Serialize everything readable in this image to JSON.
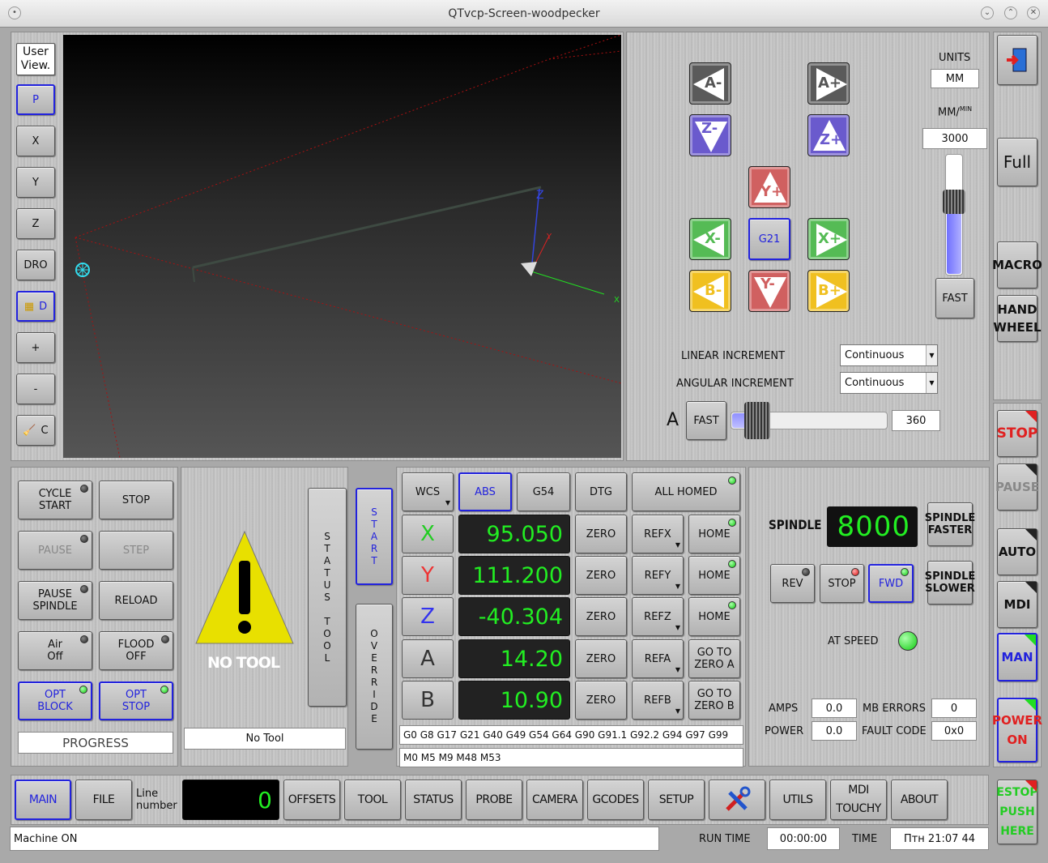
{
  "window": {
    "title": "QTvcp-Screen-woodpecker"
  },
  "view_tools": {
    "user_view": "User View.",
    "p": "P",
    "x": "X",
    "y": "Y",
    "z": "Z",
    "dro": "DRO",
    "d": "D",
    "plus": "+",
    "minus": "-",
    "c": "C"
  },
  "jog": {
    "a_minus": "A-",
    "a_plus": "A+",
    "z_minus": "Z-",
    "z_plus": "Z+",
    "y_plus": "Y+",
    "y_minus": "Y-",
    "x_minus": "X-",
    "x_plus": "X+",
    "b_minus": "B-",
    "b_plus": "B+",
    "g21": "G21",
    "units_label": "UNITS",
    "units_value": "MM",
    "rate_label": "MM/",
    "rate_sup": "MIN",
    "rate_value": "3000",
    "fast": "FAST",
    "slider_level": 0.7,
    "linear_increment_label": "LINEAR INCREMENT",
    "linear_increment_value": "Continuous",
    "angular_increment_label": "ANGULAR INCREMENT",
    "angular_increment_value": "Continuous",
    "a_label": "A",
    "a_fast": "FAST",
    "a_value": "360",
    "a_slider_level": 0.1
  },
  "right_column": {
    "full": "Full",
    "macro": "MACRO",
    "hand_wheel_1": "HAND",
    "hand_wheel_2": "WHEEL",
    "stop": "STOP",
    "pause": "PAUSE",
    "auto": "AUTO",
    "mdi": "MDI",
    "man": "MAN",
    "power_1": "POWER",
    "power_2": "ON",
    "estop_1": "ESTOP",
    "estop_2": "PUSH",
    "estop_3": "HERE"
  },
  "controls": {
    "cycle_start_1": "CYCLE",
    "cycle_start_2": "START",
    "stop": "STOP",
    "pause": "PAUSE",
    "step": "STEP",
    "pause_spindle_1": "PAUSE",
    "pause_spindle_2": "SPINDLE",
    "reload": "RELOAD",
    "air_1": "Air",
    "air_2": "Off",
    "flood_1": "FLOOD",
    "flood_2": "OFF",
    "opt_block_1": "OPT",
    "opt_block_2": "BLOCK",
    "opt_stop_1": "OPT",
    "opt_stop_2": "STOP",
    "progress": "PROGRESS"
  },
  "tool": {
    "no_tool_label": "NO TOOL",
    "tool_field": "No Tool",
    "status_tool": "STATUS TOOL",
    "start": "START",
    "override": "OVERRIDE"
  },
  "dro": {
    "wcs": "WCS",
    "abs": "ABS",
    "g54": "G54",
    "dtg": "DTG",
    "all_homed": "ALL HOMED",
    "axes": [
      {
        "name": "X",
        "value": "95.050",
        "refx": "REFX",
        "home_1": "HOME",
        "home_2": "",
        "color": "#22cc22"
      },
      {
        "name": "Y",
        "value": "111.200",
        "refx": "REFY",
        "home_1": "HOME",
        "home_2": "",
        "color": "#ee3333"
      },
      {
        "name": "Z",
        "value": "-40.304",
        "refx": "REFZ",
        "home_1": "HOME",
        "home_2": "",
        "color": "#3333ee"
      },
      {
        "name": "A",
        "value": "14.20",
        "refx": "REFA",
        "home_1": "GO TO",
        "home_2": "ZERO A",
        "color": "#333333"
      },
      {
        "name": "B",
        "value": "10.90",
        "refx": "REFB",
        "home_1": "GO TO",
        "home_2": "ZERO B",
        "color": "#333333"
      }
    ],
    "zero": "ZERO",
    "gcodes": "G0 G8 G17 G21 G40 G49 G54 G64 G90 G91.1 G92.2 G94 G97 G99",
    "mcodes": "M0 M5 M9 M48 M53"
  },
  "spindle": {
    "label": "SPINDLE",
    "rpm": "8000",
    "faster_1": "SPINDLE",
    "faster_2": "FASTER",
    "slower_1": "SPINDLE",
    "slower_2": "SLOWER",
    "rev": "REV",
    "stop": "STOP",
    "fwd": "FWD",
    "at_speed": "AT SPEED",
    "amps_label": "AMPS",
    "amps": "0.0",
    "power_label": "POWER",
    "power": "0.0",
    "mb_errors_label": "MB ERRORS",
    "mb_errors": "0",
    "fault_code_label": "FAULT CODE",
    "fault_code": "0x0"
  },
  "tabs": {
    "main": "MAIN",
    "file": "FILE",
    "line_label_1": "Line",
    "line_label_2": "number",
    "line_value": "0",
    "offsets": "OFFSETS",
    "tool": "TOOL",
    "status": "STATUS",
    "probe": "PROBE",
    "camera": "CAMERA",
    "gcodes": "GCODES",
    "setup": "SETUP",
    "utils": "UTILS",
    "mdi_touchy_1": "MDI",
    "mdi_touchy_2": "TOUCHY",
    "about": "ABOUT"
  },
  "statusbar": {
    "message": "Machine ON",
    "run_time_label": "RUN TIME",
    "run_time": "00:00:00",
    "time_label": "TIME",
    "time": "Птн 21:07 44"
  }
}
